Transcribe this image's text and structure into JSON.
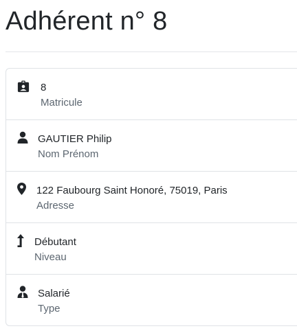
{
  "page": {
    "title": "Adhérent n° 8"
  },
  "items": [
    {
      "icon": "id-badge-icon",
      "value": "8",
      "label": "Matricule"
    },
    {
      "icon": "user-icon",
      "value": "GAUTIER Philip",
      "label": "Nom Prénom"
    },
    {
      "icon": "map-marker-icon",
      "value": "122 Faubourg Saint Honoré, 75019, Paris",
      "label": "Adresse"
    },
    {
      "icon": "level-up-icon",
      "value": "Débutant",
      "label": "Niveau"
    },
    {
      "icon": "user-tie-icon",
      "value": "Salarié",
      "label": "Type"
    }
  ]
}
